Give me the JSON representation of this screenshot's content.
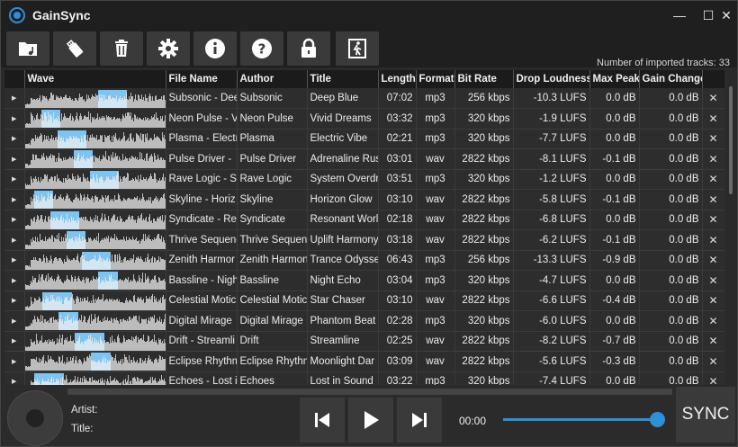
{
  "app": {
    "title": "GainSync"
  },
  "window_controls": {
    "minimize": "—",
    "maximize": "☐",
    "close": "✕"
  },
  "toolbar": {
    "buttons": [
      {
        "name": "open-folder-button",
        "icon": "music-folder-icon"
      },
      {
        "name": "usb-drive-button",
        "icon": "usb-drive-icon"
      },
      {
        "name": "delete-button",
        "icon": "trash-icon"
      },
      {
        "name": "settings-button",
        "icon": "gear-icon"
      },
      {
        "name": "info-button",
        "icon": "info-icon"
      },
      {
        "name": "help-button",
        "icon": "question-icon"
      },
      {
        "name": "lock-button",
        "icon": "lock-icon"
      },
      {
        "name": "exit-button",
        "icon": "exit-door-icon"
      }
    ],
    "imported_label": "Number of imported tracks: 33"
  },
  "table": {
    "columns": [
      "Wave",
      "File Name",
      "Author",
      "Title",
      "Length",
      "Format",
      "Bit Rate",
      "Drop Loudness",
      "Max Peak",
      "Gain Change"
    ],
    "expand_glyph": "▶",
    "delete_glyph": "✕",
    "rows": [
      {
        "file": "Subsonic - Dee",
        "author": "Subsonic",
        "title": "Deep Blue",
        "length": "07:02",
        "format": "mp3",
        "bitrate": "256 kbps",
        "loudness": "-10.3 LUFS",
        "peak": "0.0 dB",
        "gain": "0.0 dB"
      },
      {
        "file": "Neon Pulse - V",
        "author": "Neon Pulse",
        "title": "Vivid Dreams",
        "length": "03:32",
        "format": "mp3",
        "bitrate": "320 kbps",
        "loudness": "-1.9 LUFS",
        "peak": "0.0 dB",
        "gain": "0.0 dB"
      },
      {
        "file": "Plasma - Electr",
        "author": "Plasma",
        "title": "Electric Vibe",
        "length": "02:21",
        "format": "mp3",
        "bitrate": "320 kbps",
        "loudness": "-7.7 LUFS",
        "peak": "0.0 dB",
        "gain": "0.0 dB"
      },
      {
        "file": "Pulse Driver - ",
        "author": "Pulse Driver",
        "title": "Adrenaline Rus",
        "length": "03:01",
        "format": "wav",
        "bitrate": "2822 kbps",
        "loudness": "-8.1 LUFS",
        "peak": "-0.1 dB",
        "gain": "0.0 dB"
      },
      {
        "file": "Rave Logic - Sy",
        "author": "Rave Logic",
        "title": "System Overdr",
        "length": "03:51",
        "format": "mp3",
        "bitrate": "320 kbps",
        "loudness": "-1.2 LUFS",
        "peak": "0.0 dB",
        "gain": "0.0 dB"
      },
      {
        "file": "Skyline - Horiz",
        "author": "Skyline",
        "title": "Horizon Glow",
        "length": "03:10",
        "format": "wav",
        "bitrate": "2822 kbps",
        "loudness": "-5.8 LUFS",
        "peak": "-0.1 dB",
        "gain": "0.0 dB"
      },
      {
        "file": "Syndicate - Res",
        "author": "Syndicate",
        "title": "Resonant Worl",
        "length": "02:18",
        "format": "wav",
        "bitrate": "2822 kbps",
        "loudness": "-6.8 LUFS",
        "peak": "0.0 dB",
        "gain": "0.0 dB"
      },
      {
        "file": "Thrive Sequenc",
        "author": "Thrive Sequenc",
        "title": "Uplift Harmony",
        "length": "03:18",
        "format": "wav",
        "bitrate": "2822 kbps",
        "loudness": "-6.2 LUFS",
        "peak": "-0.1 dB",
        "gain": "0.0 dB"
      },
      {
        "file": "Zenith Harmor",
        "author": "Zenith Harmon",
        "title": "Trance Odysse",
        "length": "06:43",
        "format": "mp3",
        "bitrate": "256 kbps",
        "loudness": "-13.3 LUFS",
        "peak": "-0.9 dB",
        "gain": "0.0 dB"
      },
      {
        "file": "Bassline - Nigh",
        "author": "Bassline",
        "title": "Night Echo",
        "length": "03:04",
        "format": "mp3",
        "bitrate": "320 kbps",
        "loudness": "-4.7 LUFS",
        "peak": "0.0 dB",
        "gain": "0.0 dB"
      },
      {
        "file": "Celestial Motic",
        "author": "Celestial Motic",
        "title": "Star Chaser",
        "length": "03:10",
        "format": "wav",
        "bitrate": "2822 kbps",
        "loudness": "-6.6 LUFS",
        "peak": "-0.4 dB",
        "gain": "0.0 dB"
      },
      {
        "file": "Digital Mirage",
        "author": "Digital Mirage",
        "title": "Phantom Beat",
        "length": "02:28",
        "format": "mp3",
        "bitrate": "320 kbps",
        "loudness": "-6.0 LUFS",
        "peak": "0.0 dB",
        "gain": "0.0 dB"
      },
      {
        "file": "Drift - Streamli",
        "author": "Drift",
        "title": "Streamline",
        "length": "02:25",
        "format": "wav",
        "bitrate": "2822 kbps",
        "loudness": "-8.2 LUFS",
        "peak": "-0.7 dB",
        "gain": "0.0 dB"
      },
      {
        "file": "Eclipse Rhythm",
        "author": "Eclipse Rhythm",
        "title": "Moonlight Dar",
        "length": "03:09",
        "format": "wav",
        "bitrate": "2822 kbps",
        "loudness": "-5.6 LUFS",
        "peak": "-0.3 dB",
        "gain": "0.0 dB"
      },
      {
        "file": "Echoes - Lost i",
        "author": "Echoes",
        "title": "Lost in Sound",
        "length": "03:22",
        "format": "mp3",
        "bitrate": "320 kbps",
        "loudness": "-7.4 LUFS",
        "peak": "0.0 dB",
        "gain": "0.0 dB"
      }
    ]
  },
  "player": {
    "artist_label": "Artist:",
    "title_label": "Title:",
    "time": "00:00",
    "volume": 1.0,
    "sync_label": "SYNC"
  },
  "colors": {
    "accent": "#2f8fd8",
    "wave_highlight": "#7fc3ee"
  }
}
